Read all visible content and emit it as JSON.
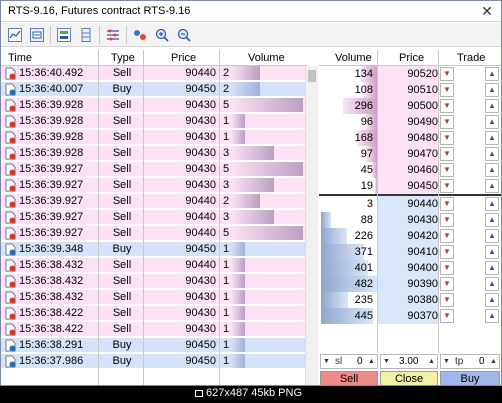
{
  "window": {
    "title": "RTS-9.16, Futures contract RTS-9.16",
    "close_glyph": "✕"
  },
  "toolbar": {
    "icons": [
      "chart-line-icon",
      "chart-tick-icon",
      "depth-of-market-icon",
      "column-icon",
      "settings-list-icon",
      "link-icon",
      "zoom-in-icon",
      "zoom-out-icon"
    ]
  },
  "trades_table": {
    "headers": {
      "time": "Time",
      "type": "Type",
      "price": "Price",
      "volume": "Volume"
    },
    "rows": [
      {
        "time": "15:36:40.492",
        "type": "Sell",
        "price": "90440",
        "volume": "2"
      },
      {
        "time": "15:36:40.007",
        "type": "Buy",
        "price": "90450",
        "volume": "2"
      },
      {
        "time": "15:36:39.928",
        "type": "Sell",
        "price": "90430",
        "volume": "5"
      },
      {
        "time": "15:36:39.928",
        "type": "Sell",
        "price": "90430",
        "volume": "1"
      },
      {
        "time": "15:36:39.928",
        "type": "Sell",
        "price": "90430",
        "volume": "1"
      },
      {
        "time": "15:36:39.928",
        "type": "Sell",
        "price": "90430",
        "volume": "3"
      },
      {
        "time": "15:36:39.927",
        "type": "Sell",
        "price": "90430",
        "volume": "5"
      },
      {
        "time": "15:36:39.927",
        "type": "Sell",
        "price": "90430",
        "volume": "3"
      },
      {
        "time": "15:36:39.927",
        "type": "Sell",
        "price": "90440",
        "volume": "2"
      },
      {
        "time": "15:36:39.927",
        "type": "Sell",
        "price": "90440",
        "volume": "3"
      },
      {
        "time": "15:36:39.927",
        "type": "Sell",
        "price": "90440",
        "volume": "5"
      },
      {
        "time": "15:36:39.348",
        "type": "Buy",
        "price": "90450",
        "volume": "1"
      },
      {
        "time": "15:36:38.432",
        "type": "Sell",
        "price": "90440",
        "volume": "1"
      },
      {
        "time": "15:36:38.432",
        "type": "Sell",
        "price": "90430",
        "volume": "1"
      },
      {
        "time": "15:36:38.432",
        "type": "Sell",
        "price": "90430",
        "volume": "1"
      },
      {
        "time": "15:36:38.422",
        "type": "Sell",
        "price": "90430",
        "volume": "1"
      },
      {
        "time": "15:36:38.422",
        "type": "Sell",
        "price": "90430",
        "volume": "1"
      },
      {
        "time": "15:36:38.291",
        "type": "Buy",
        "price": "90450",
        "volume": "1"
      },
      {
        "time": "15:36:37.986",
        "type": "Buy",
        "price": "90450",
        "volume": "1"
      }
    ]
  },
  "depth_table": {
    "headers": {
      "volume": "Volume",
      "price": "Price",
      "trade": "Trade"
    },
    "asks": [
      {
        "volume": "134",
        "price": "90520"
      },
      {
        "volume": "108",
        "price": "90510"
      },
      {
        "volume": "296",
        "price": "90500"
      },
      {
        "volume": "96",
        "price": "90490"
      },
      {
        "volume": "168",
        "price": "90480"
      },
      {
        "volume": "97",
        "price": "90470"
      },
      {
        "volume": "45",
        "price": "90460"
      },
      {
        "volume": "19",
        "price": "90450"
      }
    ],
    "bids": [
      {
        "volume": "3",
        "price": "90440"
      },
      {
        "volume": "88",
        "price": "90430"
      },
      {
        "volume": "226",
        "price": "90420"
      },
      {
        "volume": "371",
        "price": "90410"
      },
      {
        "volume": "401",
        "price": "90400"
      },
      {
        "volume": "482",
        "price": "90390"
      },
      {
        "volume": "235",
        "price": "90380"
      },
      {
        "volume": "445",
        "price": "90370"
      }
    ]
  },
  "controls": {
    "sl_label": "sl",
    "sl_value": "0",
    "volume_value": "3.00",
    "tp_label": "tp",
    "tp_value": "0",
    "sell_label": "Sell",
    "close_label": "Close",
    "buy_label": "Buy"
  },
  "colors": {
    "sell_row": "#fde2f5",
    "buy_row": "#d4e3f7",
    "sell_button": "#ee8a8a",
    "close_button": "#f2f2a4",
    "buy_button": "#9fb7ea"
  },
  "status": {
    "text": "627x487  45kb  PNG"
  }
}
